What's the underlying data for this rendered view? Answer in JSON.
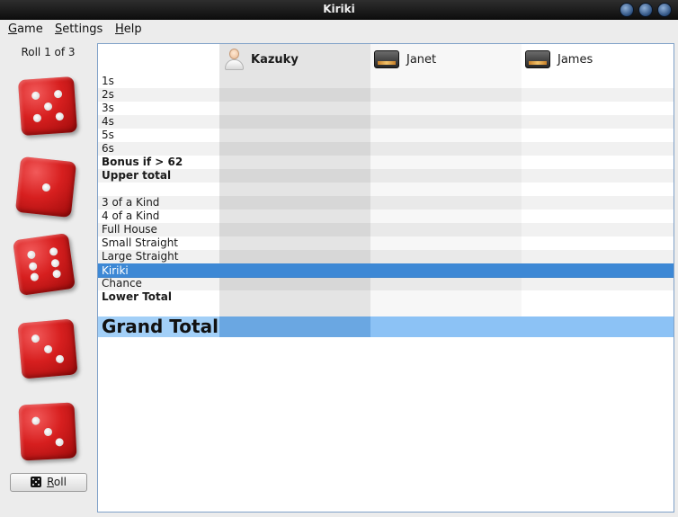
{
  "window": {
    "title": "Kiriki"
  },
  "menu": {
    "game": {
      "first": "G",
      "rest": "ame"
    },
    "settings": {
      "first": "S",
      "rest": "ettings"
    },
    "help": {
      "first": "H",
      "rest": "elp"
    }
  },
  "left_panel": {
    "roll_status": "Roll 1 of 3",
    "dice": [
      5,
      1,
      6,
      3,
      3
    ],
    "roll_button": {
      "first": "R",
      "rest": "oll"
    }
  },
  "players": [
    {
      "name": "Kazuky",
      "type": "human",
      "active": true
    },
    {
      "name": "Janet",
      "type": "computer",
      "active": false
    },
    {
      "name": "James",
      "type": "computer",
      "active": false
    }
  ],
  "rows": [
    {
      "label": "1s",
      "bold": false
    },
    {
      "label": "2s",
      "bold": false
    },
    {
      "label": "3s",
      "bold": false
    },
    {
      "label": "4s",
      "bold": false
    },
    {
      "label": "5s",
      "bold": false
    },
    {
      "label": "6s",
      "bold": false
    },
    {
      "label": "Bonus if > 62",
      "bold": true
    },
    {
      "label": "Upper total",
      "bold": true
    },
    {
      "label": "",
      "bold": false
    },
    {
      "label": "3 of a Kind",
      "bold": false
    },
    {
      "label": "4 of a Kind",
      "bold": false
    },
    {
      "label": "Full House",
      "bold": false
    },
    {
      "label": "Small Straight",
      "bold": false
    },
    {
      "label": "Large Straight",
      "bold": false
    },
    {
      "label": "Kiriki",
      "bold": false,
      "selected": true
    },
    {
      "label": "Chance",
      "bold": false
    },
    {
      "label": "Lower Total",
      "bold": true
    }
  ],
  "grand_total": {
    "label": "Grand Total"
  },
  "colors": {
    "selection": "#3d88d5",
    "grand_total_bg": "#8cc2f5",
    "active_player_column": "#e4e4e4",
    "die_red": "#d71f1f"
  }
}
